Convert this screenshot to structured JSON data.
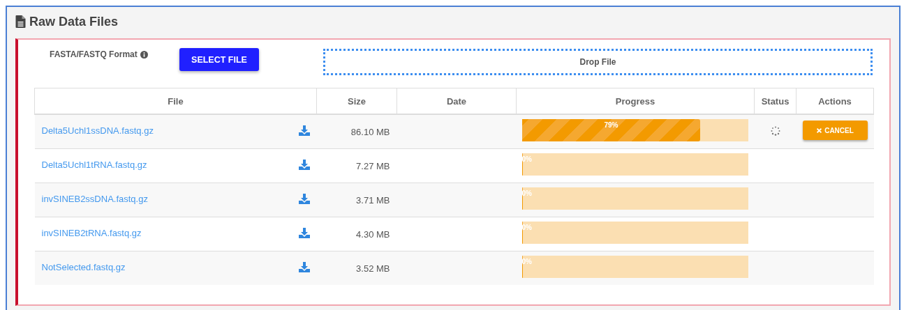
{
  "panel": {
    "title": "Raw Data Files"
  },
  "upload": {
    "format_label": "FASTA/FASTQ Format",
    "select_button": "SELECT FILE",
    "drop_zone": "Drop File"
  },
  "table": {
    "columns": [
      "File",
      "Size",
      "Date",
      "Progress",
      "Status",
      "Actions"
    ],
    "rows": [
      {
        "file": "Delta5Uchl1ssDNA.fastq.gz",
        "size": "86.10 MB",
        "level": 0.79,
        "progress": "79%",
        "uploading": true,
        "action": "CANCEL"
      },
      {
        "file": "Delta5Uchl1tRNA.fastq.gz",
        "size": "7.27 MB",
        "level": 0,
        "progress": "0%",
        "uploading": false
      },
      {
        "file": "invSINEB2ssDNA.fastq.gz",
        "size": "3.71 MB",
        "level": 0,
        "progress": "0%",
        "uploading": false
      },
      {
        "file": "invSINEB2tRNA.fastq.gz",
        "size": "4.30 MB",
        "level": 0,
        "progress": "0%",
        "uploading": false
      },
      {
        "file": "NotSelected.fastq.gz",
        "size": "3.52 MB",
        "level": 0,
        "progress": "0%",
        "uploading": false
      }
    ]
  }
}
